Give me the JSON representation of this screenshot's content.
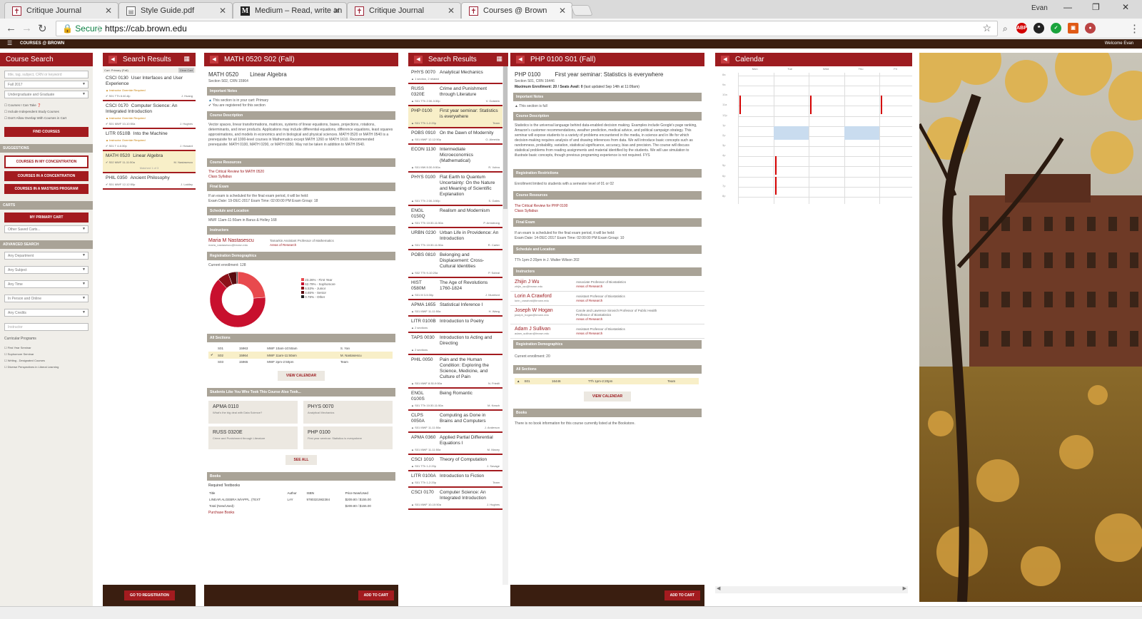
{
  "browser": {
    "tabs": [
      {
        "label": "Critique Journal",
        "icon": "brown-shield-icon"
      },
      {
        "label": "Style Guide.pdf",
        "icon": "document-icon"
      },
      {
        "label": "Medium – Read, write an",
        "icon": "medium-icon"
      },
      {
        "label": "Critique Journal",
        "icon": "brown-shield-icon"
      },
      {
        "label": "Courses @ Brown",
        "icon": "brown-shield-icon"
      }
    ],
    "user": "Evan",
    "secure_label": "Secure",
    "url": "https://cab.brown.edu"
  },
  "site": {
    "logo": "COURSES @ BROWN",
    "welcome": "Welcome Evan"
  },
  "search_panel": {
    "title": "Course Search",
    "keyword_placeholder": "title, tag, subject, CRN or keyword",
    "term": "Fall 2017",
    "level": "Undergraduate and Graduate",
    "checks": [
      "Courses I Can Take",
      "Include Independent Study Courses",
      "Don't Allow Overlap With Courses in Cart"
    ],
    "find_label": "FIND COURSES",
    "suggestions_label": "SUGGESTIONS",
    "suggestions": [
      "COURSES IN MY CONCENTRATION",
      "COURSES IN A CONCENTRATION",
      "COURSES IN A MASTERS PROGRAM"
    ],
    "carts_label": "CARTS",
    "primary_cart": "MY PRIMARY CART",
    "other_carts": "Other Saved Carts...",
    "advanced_label": "ADVANCED SEARCH",
    "advanced": [
      "Any Department",
      "Any Subject",
      "Any Time",
      "In Person and Online",
      "Any Credits"
    ],
    "instructor_placeholder": "Instructor",
    "curricular_label": "Curricular Programs",
    "curricular": [
      "First Year Seminar",
      "Sophomore Seminar",
      "Writing - Designated Courses",
      "Diverse Perspectives in Liberal Learning"
    ]
  },
  "cart_panel": {
    "title": "Search Results",
    "cart_label": "Cart: Primary (Fall)",
    "clear_label": "Clear Cart",
    "items": [
      {
        "code": "CSCI 0130",
        "title": "User Interfaces and User Experience",
        "note": "Instructor Override Required",
        "sched": "S01  TTh 6:40-8p",
        "inst": "J. Huang"
      },
      {
        "code": "CSCI 0170",
        "title": "Computer Science: An Integrated Introduction",
        "note": "Instructor Override Required",
        "sched": "S01  MWF 10-10:50a",
        "inst": "J. Hughes"
      },
      {
        "code": "LITR 0510B",
        "title": "Into the Machine",
        "note": "Instructor Override Required",
        "sched": "S01  T 4-6:30p",
        "inst": "J. Howard"
      },
      {
        "code": "MATH 0520",
        "title": "Linear Algebra",
        "note": "",
        "sched": "S02  MWF 11-11:50a",
        "inst": "M. Nastasescu",
        "extra": "Matched 1 of 3"
      },
      {
        "code": "PHIL 0350",
        "title": "Ancient Philosophy",
        "note": "",
        "sched": "S01  MWF 12-12:50p",
        "inst": "J. Laidley"
      }
    ],
    "go_label": "GO TO REGISTRATION"
  },
  "math_panel": {
    "title": "MATH 0520 S02 (Fall)",
    "code": "MATH 0520",
    "name": "Linear Algebra",
    "section": "Section S02, CRN 15964",
    "notes_label": "Important Notes",
    "notes": [
      "This section is in your cart: Primary",
      "You are registered for this section"
    ],
    "desc_label": "Course Description",
    "desc": "Vector spaces, linear transformations, matrices, systems of linear equations, bases, projections, rotations, determinants, and inner products. Applications may include differential equations, difference equations, least squares approximations, and models in economics and in biological and physical sciences. MATH 0520 or MATH 0540 is a prerequisite for all 1000-level courses in Mathematics except MATH 1260 or MATH 1610. Recommended prerequisite: MATH 0100, MATH 0200, or MATH 0350. May not be taken in addition to MATH 0540.",
    "resources_label": "Course Resources",
    "resources": [
      "The Critical Review for MATH 0520",
      "Class Syllabus"
    ],
    "exam_label": "Final Exam",
    "exam": "If an exam is scheduled for the final exam period, it will be held:",
    "exam_date": "Exam Date: 19-DEC-2017 Exam Time: 02:00:00 PM Exam Group: 18",
    "loc_label": "Schedule and Location",
    "loc": "MWF 11am-11:50am in Barus & Holley 168",
    "inst_label": "Instructors",
    "inst_name": "Maria M Nastasescu",
    "inst_email": "maria_nastasescu@brown.edu",
    "inst_title": "Tamarkin Assistant Professor of Mathematics",
    "inst_areas": "Areas of Research",
    "demo_label": "Registration Demographics",
    "enroll": "Current enrollment: 128",
    "legend": [
      "23.26% - First Year",
      "62.79% - Sophomore",
      "6.53% - Junior",
      "4.65% - Senior",
      "0.78% - Other"
    ],
    "sections_label": "All Sections",
    "sections": [
      {
        "s": "S01",
        "crn": "15963",
        "time": "MWF 10am-10:50am",
        "inst": "S. Yan"
      },
      {
        "s": "S02",
        "crn": "15964",
        "time": "MWF 11am-11:50am",
        "inst": "M. Nastasescu"
      },
      {
        "s": "S03",
        "crn": "15965",
        "time": "MWF 2pm-2:50pm",
        "inst": "Team"
      }
    ],
    "view_cal": "VIEW CALENDAR",
    "also_label": "Students Like You Who Took This Course Also Took...",
    "also": [
      {
        "code": "APMA 0110",
        "sub": "What's the big deal with Data Science?"
      },
      {
        "code": "PHYS 0070",
        "sub": "Analytical Mechanics"
      },
      {
        "code": "RUSS 0320E",
        "sub": "Crime and Punishment through Literature"
      },
      {
        "code": "PHP 0100",
        "sub": "First year seminar: Statistics is everywhere"
      }
    ],
    "see_all": "SEE ALL",
    "books_label": "Books",
    "books_req": "Required Textbooks",
    "book_head": [
      "Title",
      "Author",
      "ISBN",
      "Price New/Used"
    ],
    "book_row": [
      "LINEAR ALGEBRA W/APPL. (TEXT",
      "LAY",
      "9780321982384",
      "$209.80 / $155.00"
    ],
    "book_total": [
      "Total (New/Used):",
      "$209.80 / $155.00"
    ],
    "purchase": "Purchase Books",
    "add_label": "ADD TO CART"
  },
  "results_panel": {
    "title": "Search Results",
    "items": [
      {
        "code": "PHYS 0070",
        "title": "Analytical Mechanics",
        "meta": "1 section, 2 related",
        "inst": ""
      },
      {
        "code": "RUSS 0320E",
        "title": "Crime and Punishment through Literature",
        "meta": "S01  TTh 2:30-3:30p",
        "inst": "V. Golstein"
      },
      {
        "code": "PHP 0100",
        "title": "First year seminar: Statistics is everywhere",
        "meta": "S01  TTh 1-2:20p",
        "inst": "Team"
      },
      {
        "code": "POBS 0910",
        "title": "On the Dawn of Modernity",
        "meta": "S01  MWF 12-12:50p",
        "inst": "O. Almeida"
      },
      {
        "code": "ECON 1130",
        "title": "Intermediate Microeconomics (Mathematical)",
        "meta": "S01  MW 8:30-9:50a",
        "inst": "R. Vohra"
      },
      {
        "code": "PHYS 0100",
        "title": "Flat Earth to Quantum Uncertainty: On the Nature and Meaning of Scientific Explanation",
        "meta": "S01  TTh 2:30-3:50p",
        "inst": "S. Gates"
      },
      {
        "code": "ENGL 0150Q",
        "title": "Realism and Modernism",
        "meta": "S01  TTh 10:30-11:50a",
        "inst": "P. Armstrong"
      },
      {
        "code": "URBN 0230",
        "title": "Urban Life in Providence: An Introduction",
        "meta": "S01  TTh 10:30-11:50a",
        "inst": "R. Carter"
      },
      {
        "code": "POBS 0810",
        "title": "Belonging and Displacement: Cross-Cultural Identities",
        "meta": "S02  TTh 9-10:20a",
        "inst": "P. Sobral"
      },
      {
        "code": "HIST 0580M",
        "title": "The Age of Revolutions 1760-1824",
        "meta": "S01  M 3-5:30p",
        "inst": "J. Mumford"
      },
      {
        "code": "APMA 1655",
        "title": "Statistical Inference I",
        "meta": "S01  MWF 11-11:50a",
        "inst": "H. Wang"
      },
      {
        "code": "LITR 0100B",
        "title": "Introduction to Poetry",
        "meta": "2 sections",
        "inst": ""
      },
      {
        "code": "TAPS 0030",
        "title": "Introduction to Acting and Directing",
        "meta": "2 sections",
        "inst": ""
      },
      {
        "code": "PHIL 0050",
        "title": "Pain and the Human Condition: Exploring the Science, Medicine, and Culture of Pain",
        "meta": "S01  MWF 8:30-9:50a",
        "inst": "N. Friedli"
      },
      {
        "code": "ENGL 0100S",
        "title": "Being Romantic",
        "meta": "S01  TTh 10:30-11:50a",
        "inst": "M. Keach"
      },
      {
        "code": "CLPS 0050A",
        "title": "Computing as Done in Brains and Computers",
        "meta": "S01  MWF 11-11:50a",
        "inst": "J. Anderson"
      },
      {
        "code": "APMA 0360",
        "title": "Applied Partial Differential Equations I",
        "meta": "S01  MWF 11-11:50a",
        "inst": "M. Maxey"
      },
      {
        "code": "CSCI 1010",
        "title": "Theory of Computation",
        "meta": "S01  TTh 1-2:20p",
        "inst": "J. Savage"
      },
      {
        "code": "LITR 0100A",
        "title": "Introduction to Fiction",
        "meta": "S01  TTh 1-2:20p",
        "inst": "Team"
      },
      {
        "code": "CSCI 0170",
        "title": "Computer Science: An Integrated Introduction",
        "meta": "S01  MWF 10-10:50a",
        "inst": "J. Hughes"
      }
    ]
  },
  "php_panel": {
    "title": "PHP 0100 S01 (Fall)",
    "code": "PHP 0100",
    "name": "First year seminar: Statistics is everywhere",
    "section": "Section S01, CRN 16446",
    "max": "Maximum Enrollment: 20 / Seats Avail: 0",
    "updated": "(last updated Sep 14th at 11:09am)",
    "notes_label": "Important Notes",
    "note": "This section is full",
    "desc_label": "Course Description",
    "desc": "Statistics is the universal language behind data-enabled decision making. Examples include Google's page ranking, Amazon's customer recommendations, weather prediction, medical advice, and political campaign strategy. This seminar will expose students to a variety of problems encountered in the media, in science and in life for which decision-making requires analysis of and drawing inferences from data. We will introduce basic concepts such as randomness, probability, variation, statistical significance, accuracy, bias and precision. The course will discuss statistical problems from reading assignments and material identified by the students. We will use simulation to illustrate basic concepts, though previous programing experience is not required. FYS",
    "restr_label": "Registration Restrictions",
    "restr": "Enrollment limited to students with a semester level of 01 or 02",
    "resources_label": "Course Resources",
    "resources": [
      "The Critical Review for PHP 0100",
      "Class Syllabus"
    ],
    "exam_label": "Final Exam",
    "exam": "If an exam is scheduled for the final exam period, it will be held:",
    "exam_date": "Exam Date: 14-DEC-2017 Exam Time: 02:00:00 PM Exam Group: 10",
    "loc_label": "Schedule and Location",
    "loc": "TTh 1pm-2:20pm in J. Walter Wilson 202",
    "inst_label": "Instructors",
    "instructors": [
      {
        "name": "Zhijin J Wu",
        "email": "zhijin_wu@brown.edu",
        "title": "Associate Professor of Biostatistics",
        "areas": "Areas of Research"
      },
      {
        "name": "Lorin A Crawford",
        "email": "lorin_crawford@brown.edu",
        "title": "Assistant Professor of Biostatistics",
        "areas": "Areas of Research"
      },
      {
        "name": "Joseph W Hogan",
        "email": "joseph_hogan@brown.edu",
        "title": "Carole and Lawrence Sirovich Professor of Public Health",
        "title2": "Professor of Biostatistics",
        "areas": "Areas of Research"
      },
      {
        "name": "Adam J Sullivan",
        "email": "adam_sullivan@brown.edu",
        "title": "Assistant Professor of Biostatistics",
        "areas": "Areas of Research"
      }
    ],
    "demo_label": "Registration Demographics",
    "enroll": "Current enrollment: 20",
    "sections_label": "All Sections",
    "section_row": {
      "s": "S01",
      "crn": "16446",
      "time": "TTh 1pm-2:20pm",
      "inst": "Team"
    },
    "view_cal": "VIEW CALENDAR",
    "books_label": "Books",
    "books": "There is no book information for this course currently listed at the Bookstore.",
    "add_label": "ADD TO CART"
  },
  "calendar": {
    "title": "Calendar",
    "days": [
      "Mon",
      "Tue",
      "Wed",
      "Thu",
      "Fri"
    ],
    "hours": [
      "8a",
      "9a",
      "10a",
      "11a",
      "12p",
      "1p",
      "2p",
      "3p",
      "4p",
      "5p",
      "6p",
      "7p",
      "8p"
    ]
  }
}
